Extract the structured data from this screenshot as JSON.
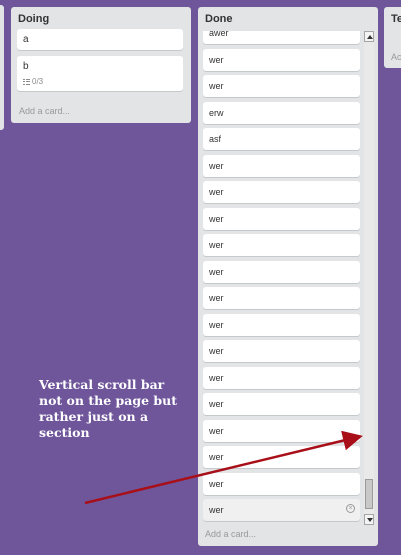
{
  "lists": {
    "doing": {
      "title": "Doing",
      "cards": [
        {
          "text": "a"
        },
        {
          "text": "b",
          "checklist": "0/3"
        }
      ],
      "add_card": "Add a card..."
    },
    "done": {
      "title": "Done",
      "cards": [
        "awer",
        "wer",
        "wer",
        "erw",
        "asf",
        "wer",
        "wer",
        "wer",
        "wer",
        "wer",
        "wer",
        "wer",
        "wer",
        "wer",
        "wer",
        "wer",
        "wer",
        "wer",
        "wer"
      ],
      "add_card": "Add a card..."
    },
    "third": {
      "title": "Te",
      "add_card": "Ac"
    }
  },
  "annotation": {
    "text": "Vertical scroll bar not on the page but rather just on a section",
    "arrow_color": "#a80f18"
  },
  "colors": {
    "board_bg": "#6f569b",
    "list_bg": "#e2e4e6"
  }
}
